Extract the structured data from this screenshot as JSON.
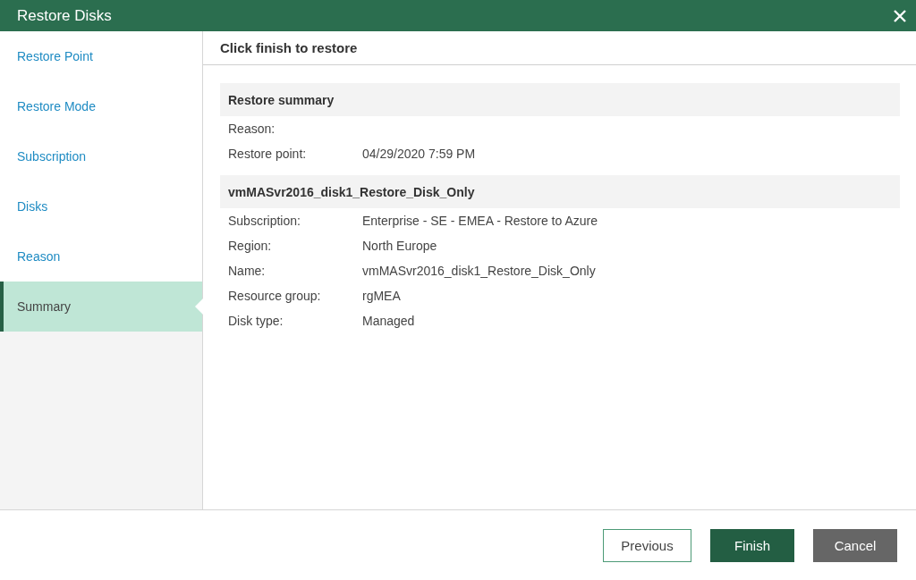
{
  "window": {
    "title": "Restore Disks"
  },
  "sidebar": {
    "items": [
      {
        "label": "Restore Point",
        "selected": false
      },
      {
        "label": "Restore Mode",
        "selected": false
      },
      {
        "label": "Subscription",
        "selected": false
      },
      {
        "label": "Disks",
        "selected": false
      },
      {
        "label": "Reason",
        "selected": false
      },
      {
        "label": "Summary",
        "selected": true
      }
    ]
  },
  "content": {
    "heading": "Click finish to restore",
    "sections": [
      {
        "title": "Restore summary",
        "rows": [
          {
            "label": "Reason:"
          },
          {
            "label": "Restore point:",
            "value": "04/29/2020 7:59 PM"
          }
        ]
      },
      {
        "title": "vmMASvr2016_disk1_Restore_Disk_Only",
        "rows": [
          {
            "label": "Subscription:",
            "value": "Enterprise - SE - EMEA - Restore to Azure"
          },
          {
            "label": "Region:",
            "value": "North Europe"
          },
          {
            "label": "Name:",
            "value": "vmMASvr2016_disk1_Restore_Disk_Only"
          },
          {
            "label": "Resource group:",
            "value": "rgMEA"
          },
          {
            "label": "Disk type:",
            "value": "Managed"
          }
        ]
      }
    ]
  },
  "buttons": [
    {
      "label": "Previous",
      "kind": "outline"
    },
    {
      "label": "Finish",
      "kind": "primary"
    },
    {
      "label": "Cancel",
      "kind": "secondary"
    }
  ]
}
